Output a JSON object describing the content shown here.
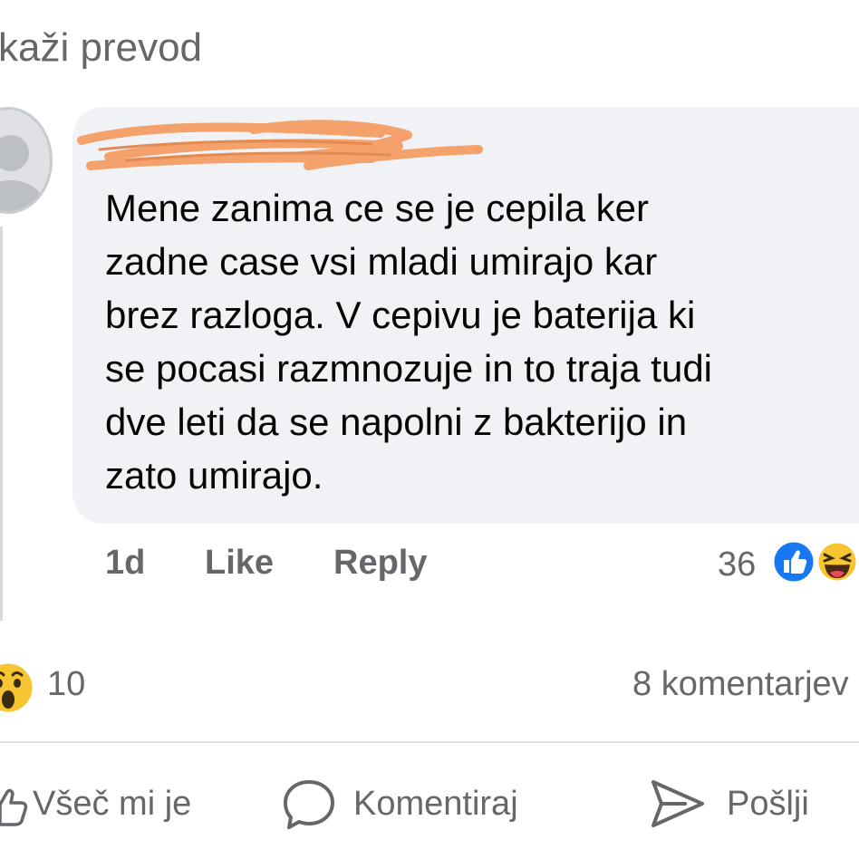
{
  "translate": {
    "label": "kaži prevod"
  },
  "comment": {
    "author_redacted": true,
    "text": "Mene zanima ce se je cepila ker\nzadne case vsi mladi umirajo kar\nbrez razloga. V cepivu je baterija ki\nse pocasi razmnozuje in to traja tudi\ndve leti da se napolni z bakterijo in\nzato umirajo.",
    "time": "1d",
    "like_label": "Like",
    "reply_label": "Reply",
    "reaction_count": "36",
    "reactions": [
      "like-icon",
      "haha-icon"
    ]
  },
  "post": {
    "reactions": [
      "wow-icon"
    ],
    "reaction_count": "10",
    "comments_count": "8 komentarjev",
    "actions": [
      {
        "label": "Všeč mi je",
        "icon": "thumbs-up-icon"
      },
      {
        "label": "Komentiraj",
        "icon": "comment-icon"
      },
      {
        "label": "Pošlji",
        "icon": "send-icon"
      }
    ]
  },
  "colors": {
    "bubble_bg": "#f0f2f5",
    "text": "#050505",
    "secondary_text": "#65676b",
    "like_blue": "#1877f2",
    "emoji_yellow": "#f7c531",
    "redaction_orange": "#f4a16c"
  }
}
